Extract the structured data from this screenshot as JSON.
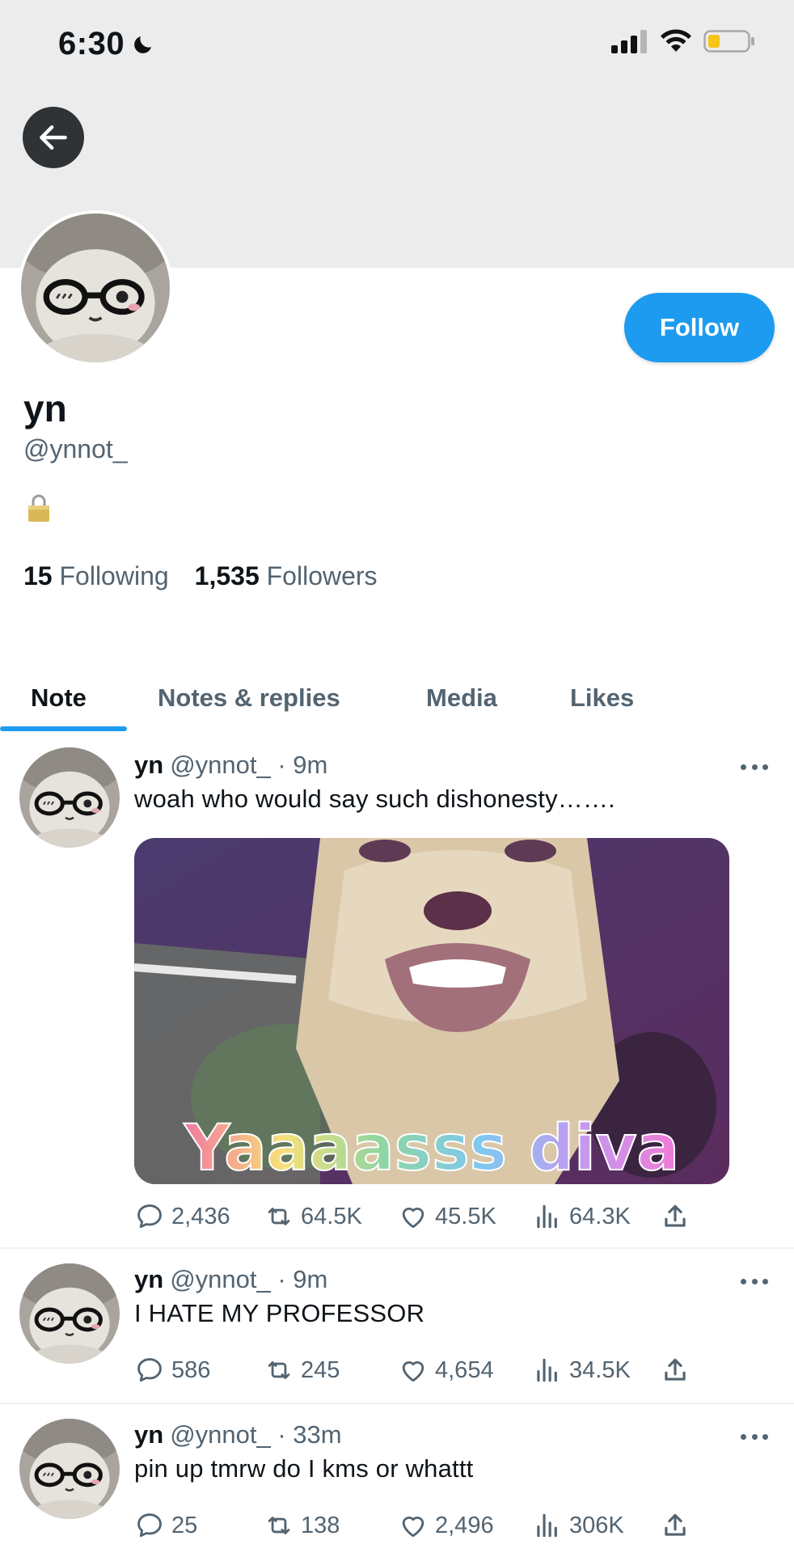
{
  "status_bar": {
    "time": "6:30"
  },
  "profile": {
    "display_name": "yn",
    "handle": "@ynnot_",
    "follow_label": "Follow",
    "following_count": "15",
    "following_label": "Following",
    "followers_count": "1,535",
    "followers_label": "Followers",
    "protected": true
  },
  "tabs": [
    {
      "label": "Note",
      "active": true
    },
    {
      "label": "Notes & replies",
      "active": false
    },
    {
      "label": "Media",
      "active": false
    },
    {
      "label": "Likes",
      "active": false
    }
  ],
  "tweets": [
    {
      "name": "yn",
      "meta": "@ynnot_ · 9m",
      "text": "woah who would say such dishonesty…….",
      "media_caption": "Yaaaasss diva",
      "replies": "2,436",
      "reposts": "64.5K",
      "likes": "45.5K",
      "views": "64.3K"
    },
    {
      "name": "yn",
      "meta": "@ynnot_ · 9m",
      "text": "I HATE MY PROFESSOR",
      "replies": "586",
      "reposts": "245",
      "likes": "4,654",
      "views": "34.5K"
    },
    {
      "name": "yn",
      "meta": "@ynnot_ · 33m",
      "text": "pin up tmrw do I kms or whattt",
      "replies": "25",
      "reposts": "138",
      "likes": "2,496",
      "views": "306K"
    }
  ],
  "colors": {
    "accent": "#1d9bf0",
    "muted": "#536471",
    "header_band": "#ececec"
  }
}
